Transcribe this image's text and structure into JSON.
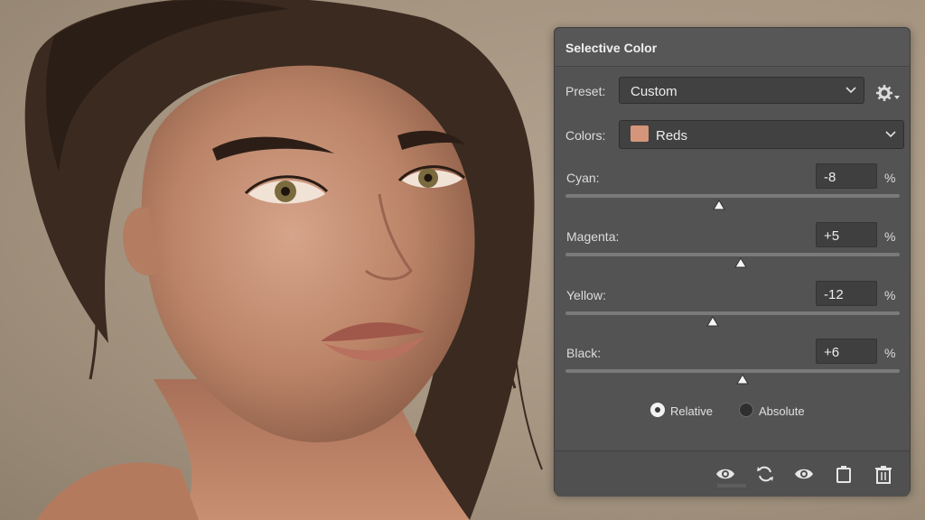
{
  "panel": {
    "title": "Selective Color",
    "preset_label": "Preset:",
    "preset_value": "Custom",
    "colors_label": "Colors:",
    "colors_value": "Reds",
    "swatch_color": "#d4957a",
    "sliders": [
      {
        "label": "Cyan:",
        "value": "-8",
        "unit": "%",
        "position": -8
      },
      {
        "label": "Magenta:",
        "value": "+5",
        "unit": "%",
        "position": 5
      },
      {
        "label": "Yellow:",
        "value": "-12",
        "unit": "%",
        "position": -12
      },
      {
        "label": "Black:",
        "value": "+6",
        "unit": "%",
        "position": 6
      }
    ],
    "slider_range": [
      -100,
      100
    ],
    "method": {
      "options": [
        "Relative",
        "Absolute"
      ],
      "selected": "Relative"
    },
    "footer_icons": [
      "visibility-icon",
      "reset-icon",
      "visibility-toggle-icon",
      "clip-to-layer-icon",
      "trash-icon"
    ]
  },
  "colors": {
    "panel_bg": "#535353",
    "field_bg": "#414141",
    "text": "#e6e6e6"
  }
}
